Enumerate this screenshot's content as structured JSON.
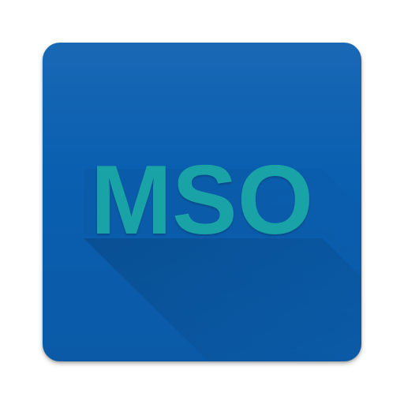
{
  "app_icon": {
    "label": "MSO",
    "background_color": "#0a5fb0",
    "text_color": "#1aa3a7"
  }
}
